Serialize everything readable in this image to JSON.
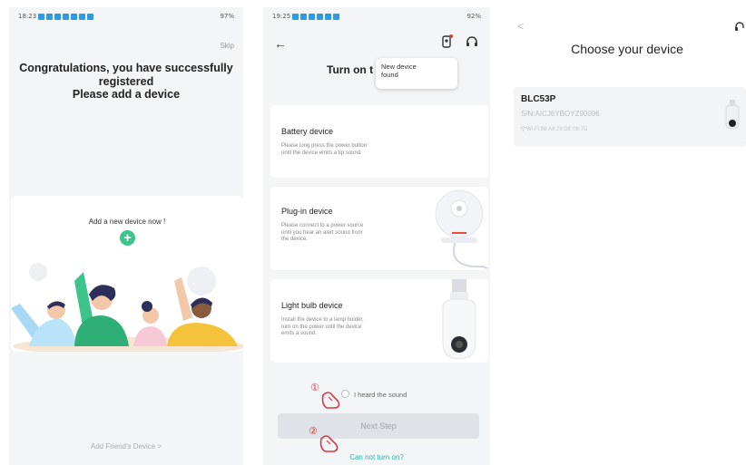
{
  "screen1": {
    "status_time": "18:23",
    "status_right": "97%",
    "skip_label": "Skip",
    "congrats_line1": "Congratulations, you have successfully",
    "congrats_line2": "registered",
    "congrats_line3": "Please add a device",
    "add_device_label": "Add a new device now !",
    "add_friends_label": "Add Friend's Device  >"
  },
  "screen2": {
    "status_time": "19:25",
    "status_right": "92%",
    "title": "Turn on t",
    "tooltip_line1": "New device",
    "tooltip_line2": "found",
    "devices": [
      {
        "name": "Battery device",
        "desc1": "Please long press the power button",
        "desc2": "until the device emits a tip sound.",
        "desc3": ""
      },
      {
        "name": "Plug-in device",
        "desc1": "Please connect to a power source",
        "desc2": "until you hear an alert sound from",
        "desc3": "the device."
      },
      {
        "name": "Light bulb device",
        "desc1": "Install the device to a lamp holder,",
        "desc2": "turn on the power until the device",
        "desc3": "emits a sound."
      }
    ],
    "heard_sound_label": "I heard the sound",
    "next_step_label": "Next Step",
    "cannot_turn_on_label": "Can not turn on?",
    "step1": "①",
    "step2": "②"
  },
  "screen3": {
    "back_label": "<",
    "title": "Choose your device",
    "model": "BLC53P",
    "serial": "S/N:AICJ6YBOYZ90096",
    "wifi": "Wi-Fi:98:A8:29:DE:06:7D"
  },
  "colors": {
    "accent_green": "#3cc48a",
    "teal_link": "#2bb5b0",
    "status_blue": "#2d9be0",
    "hand_red": "#d9363e"
  },
  "icons": [
    "wifi-icon",
    "headset-icon",
    "camera-icon",
    "back-arrow-icon",
    "plus-icon",
    "hand-tap-icon"
  ]
}
